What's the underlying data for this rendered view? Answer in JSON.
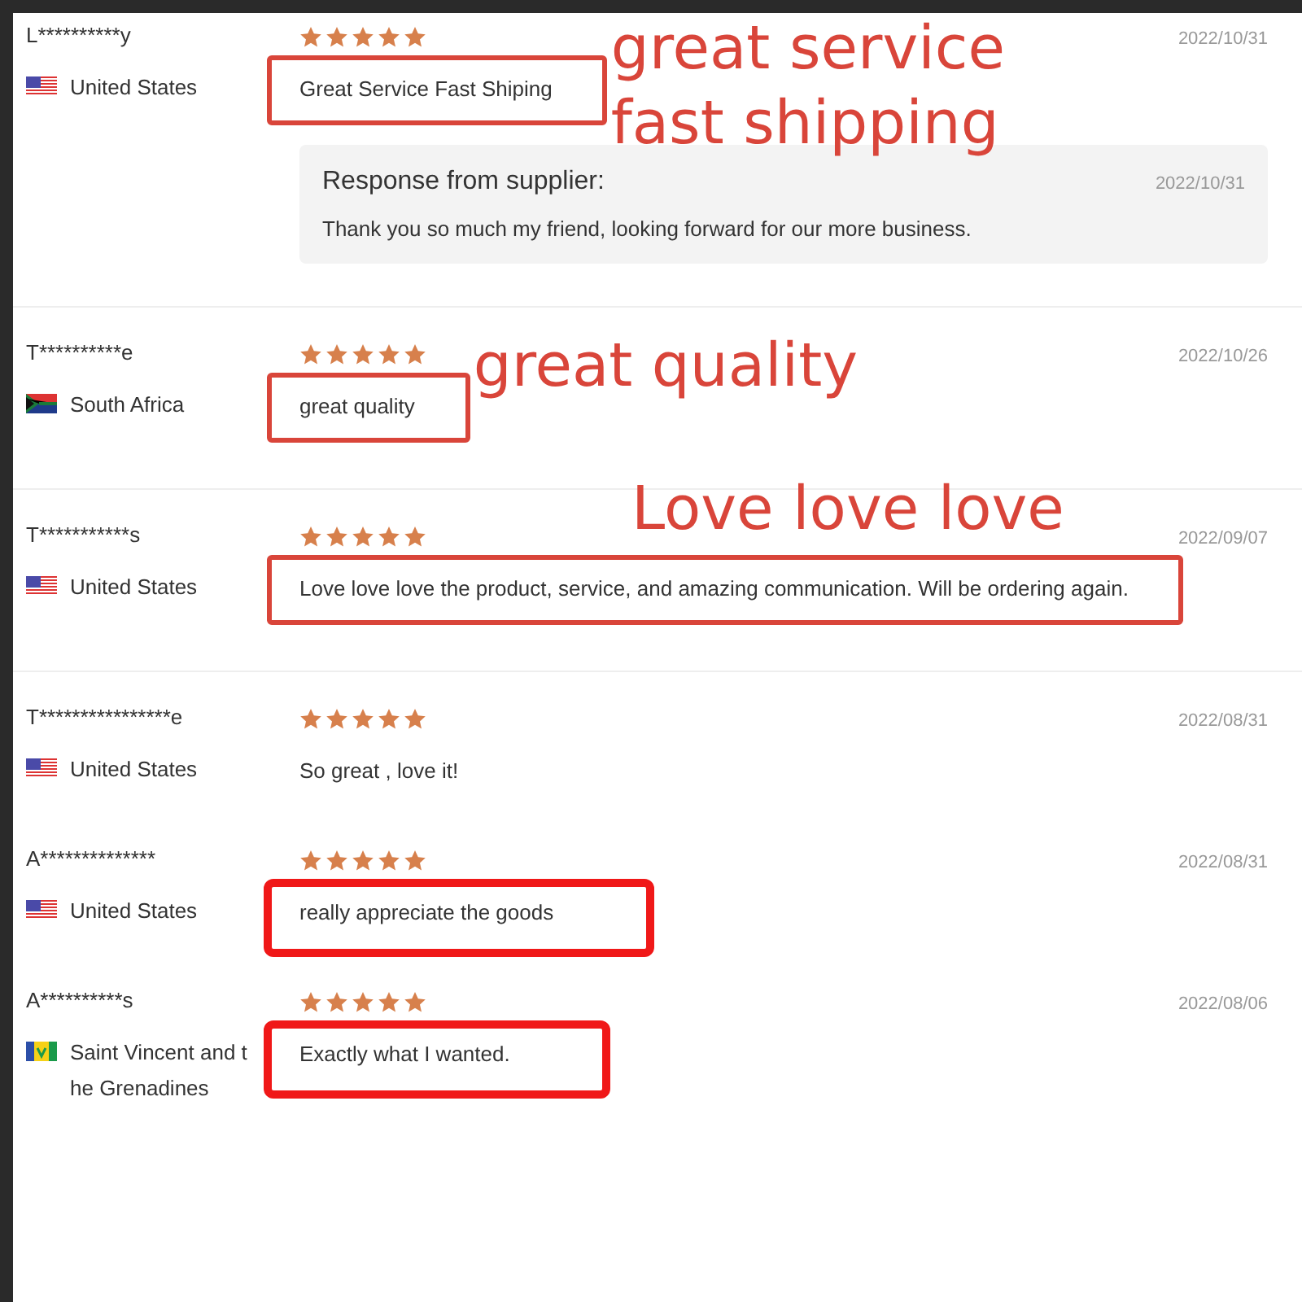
{
  "reviews": [
    {
      "name": "L**********y",
      "country": "United States",
      "kind": "us",
      "stars": 5,
      "comment": "Great Service Fast Shiping",
      "date": "2022/10/31",
      "divider": true,
      "annotation": {
        "kind": "thin",
        "note": "great service fast shipping"
      },
      "response": {
        "title": "Response from supplier:",
        "date": "2022/10/31",
        "text": "Thank you so much my friend, looking forward for our more business."
      }
    },
    {
      "name": "T**********e",
      "country": "South Africa",
      "kind": "za",
      "stars": 5,
      "comment": "great quality",
      "date": "2022/10/26",
      "divider": true,
      "annotation": {
        "kind": "thin",
        "note": "great quality"
      }
    },
    {
      "name": "T***********s",
      "country": "United States",
      "kind": "us",
      "stars": 5,
      "comment": "Love love love the product, service, and amazing communication. Will be ordering again.",
      "date": "2022/09/07",
      "divider": true,
      "annotation": {
        "kind": "thin",
        "note": "Love love love"
      }
    },
    {
      "name": "T****************e",
      "country": "United States",
      "kind": "us",
      "stars": 5,
      "comment": "So great , love it!",
      "date": "2022/08/31",
      "divider": false
    },
    {
      "name": "A**************",
      "country": "United States",
      "kind": "us",
      "stars": 5,
      "comment": "really appreciate the goods",
      "date": "2022/08/31",
      "divider": false,
      "annotation": {
        "kind": "thick"
      }
    },
    {
      "name": "A**********s",
      "country": "Saint Vincent and the Grenadines",
      "kind": "vc",
      "stars": 5,
      "comment": "Exactly what I wanted.",
      "date": "2022/08/06",
      "divider": false,
      "annotation": {
        "kind": "thick"
      }
    }
  ]
}
